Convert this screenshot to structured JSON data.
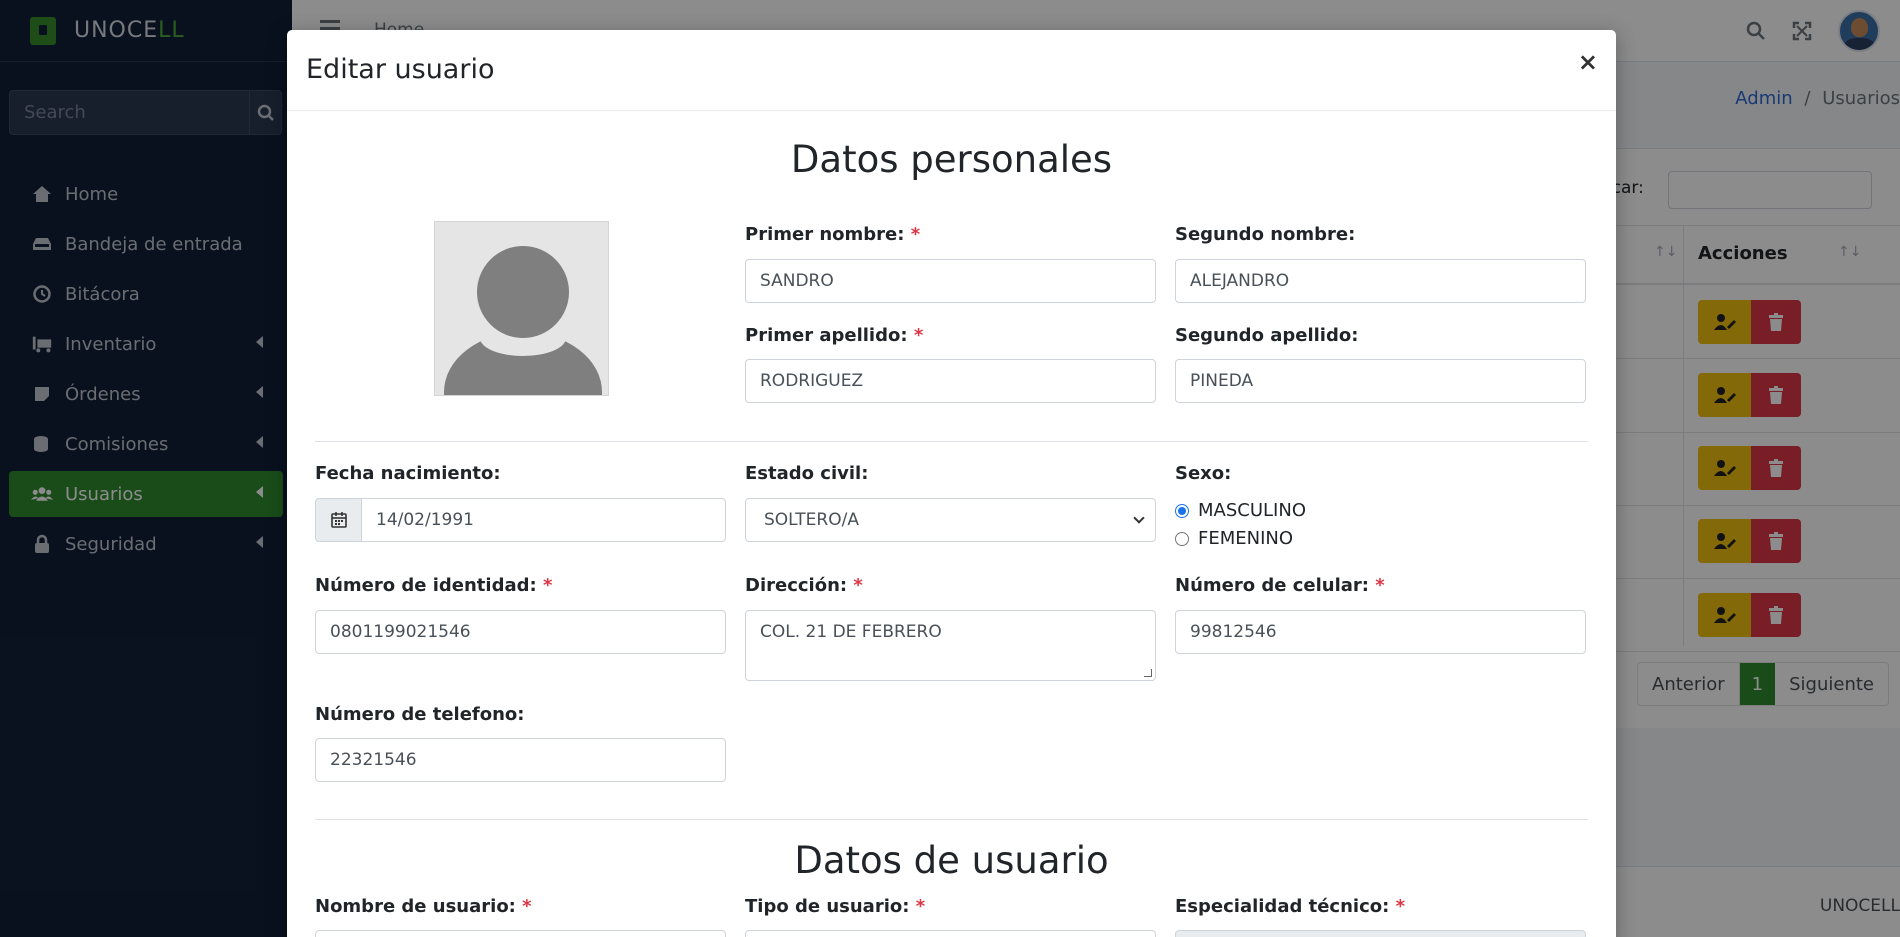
{
  "sidebar": {
    "brand": "UNOCE",
    "brand_accent": "LL",
    "search_placeholder": "Search",
    "items": [
      {
        "label": "Home",
        "icon": "home-icon"
      },
      {
        "label": "Bandeja de entrada",
        "icon": "inbox-icon"
      },
      {
        "label": "Bitácora",
        "icon": "history-icon"
      },
      {
        "label": "Inventario",
        "icon": "truck-icon"
      },
      {
        "label": "Órdenes",
        "icon": "sticky-note-icon"
      },
      {
        "label": "Comisiones",
        "icon": "coins-icon"
      },
      {
        "label": "Usuarios",
        "icon": "users-icon",
        "active": true
      },
      {
        "label": "Seguridad",
        "icon": "lock-icon"
      }
    ]
  },
  "topbar": {
    "home_label": "Home"
  },
  "breadcrumb": {
    "admin": "Admin",
    "sep": "/",
    "current": "Usuarios"
  },
  "table": {
    "search_label": "uscar:",
    "actions_header": "Acciones",
    "pager": {
      "prev": "Anterior",
      "current": "1",
      "next": "Siguiente"
    }
  },
  "footer": {
    "text": "UNOCELL"
  },
  "modal": {
    "title": "Editar usuario",
    "close": "×",
    "section_personal": "Datos personales",
    "section_user": "Datos de usuario",
    "fields": {
      "primer_nombre": {
        "label": "Primer nombre:",
        "value": "SANDRO"
      },
      "segundo_nombre": {
        "label": "Segundo nombre:",
        "value": "ALEJANDRO"
      },
      "primer_apellido": {
        "label": "Primer apellido:",
        "value": "RODRIGUEZ"
      },
      "segundo_apellido": {
        "label": "Segundo apellido:",
        "value": "PINEDA"
      },
      "fecha_nacimiento": {
        "label": "Fecha nacimiento:",
        "value": "14/02/1991"
      },
      "estado_civil": {
        "label": "Estado civil:",
        "value": "SOLTERO/A"
      },
      "sexo": {
        "label": "Sexo:",
        "options": [
          "MASCULINO",
          "FEMENINO"
        ],
        "selected": "MASCULINO"
      },
      "identidad": {
        "label": "Número de identidad:",
        "value": "0801199021546"
      },
      "direccion": {
        "label": "Dirección:",
        "value": "COL. 21 DE FEBRERO"
      },
      "celular": {
        "label": "Número de celular:",
        "value": "99812546"
      },
      "telefono": {
        "label": "Número de telefono:",
        "value": "22321546"
      },
      "nombre_usuario": {
        "label": "Nombre de usuario:"
      },
      "tipo_usuario": {
        "label": "Tipo de usuario:"
      },
      "especialidad": {
        "label": "Especialidad técnico:"
      }
    },
    "required_mark": "*"
  }
}
